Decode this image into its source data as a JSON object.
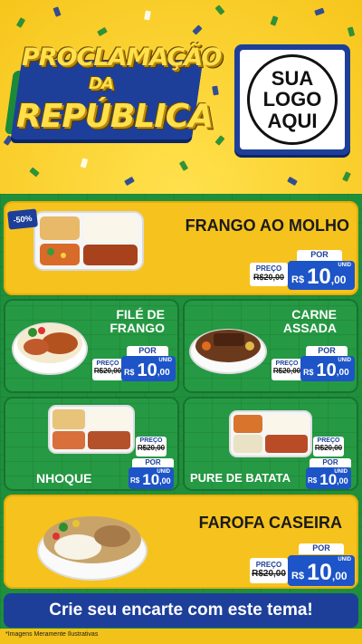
{
  "header": {
    "title_line1": "PROCLAMAÇÃO",
    "title_line2": "DA",
    "title_line3": "REPÚBLICA",
    "logo_line1": "SUA",
    "logo_line2": "LOGO",
    "logo_line3": "AQUI"
  },
  "products": [
    {
      "name": "FRANGO AO MOLHO",
      "badge": "-50%",
      "por": "POR",
      "preco": "PREÇO",
      "old_price": "R$20,00",
      "currency": "R$",
      "price_int": "10",
      "price_cents": ",00",
      "unit": "UNID"
    },
    {
      "name_line1": "FILÉ DE",
      "name_line2": "FRANGO",
      "por": "POR",
      "preco": "PREÇO",
      "old_price": "R$20,00",
      "currency": "R$",
      "price_int": "10",
      "price_cents": ",00",
      "unit": "UNID"
    },
    {
      "name_line1": "CARNE",
      "name_line2": "ASSADA",
      "por": "POR",
      "preco": "PREÇO",
      "old_price": "R$20,00",
      "currency": "R$",
      "price_int": "10",
      "price_cents": ",00",
      "unit": "UNID"
    },
    {
      "name": "NHOQUE",
      "por": "POR",
      "preco": "PREÇO",
      "old_price": "R$20,00",
      "currency": "R$",
      "price_int": "10",
      "price_cents": ",00",
      "unit": "UNID"
    },
    {
      "name": "PURE DE BATATA",
      "por": "POR",
      "preco": "PREÇO",
      "old_price": "R$20,00",
      "currency": "R$",
      "price_int": "10",
      "price_cents": ",00",
      "unit": "UNID"
    },
    {
      "name": "FAROFA CASEIRA",
      "por": "POR",
      "preco": "PREÇO",
      "old_price": "R$20,00",
      "currency": "R$",
      "price_int": "10",
      "price_cents": ",00",
      "unit": "UNID"
    }
  ],
  "banner": "Crie seu encarte com este tema!",
  "footnote": "*Imagens Meramente Ilustrativas",
  "colors": {
    "yellow": "#f6c21d",
    "green": "#1f8f3c",
    "blue": "#1d3f9a",
    "price_blue": "#1d54c7"
  }
}
